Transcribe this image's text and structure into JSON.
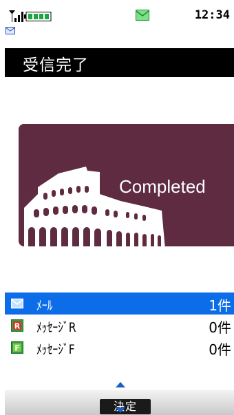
{
  "status_bar": {
    "time": "12:34",
    "signal_icon": "signal-antenna-icon",
    "battery_icon": "battery-icon",
    "mail_icon": "mail-notification-icon"
  },
  "title": "受信完了",
  "banner": {
    "text": "Completed",
    "image_icon": "colosseum-icon",
    "color": "#5f2b41"
  },
  "list": [
    {
      "label": "ﾒｰﾙ",
      "count": "1件",
      "icon": "mail-icon",
      "selected": true
    },
    {
      "label": "ﾒｯｾｰｼﾞR",
      "count": "0件",
      "icon": "r-badge-icon",
      "selected": false
    },
    {
      "label": "ﾒｯｾｰｼﾞF",
      "count": "0件",
      "icon": "f-badge-icon",
      "selected": false
    }
  ],
  "softkey": {
    "center": "決定"
  },
  "colors": {
    "selection": "#0d6de8",
    "title_bg": "#000000"
  }
}
